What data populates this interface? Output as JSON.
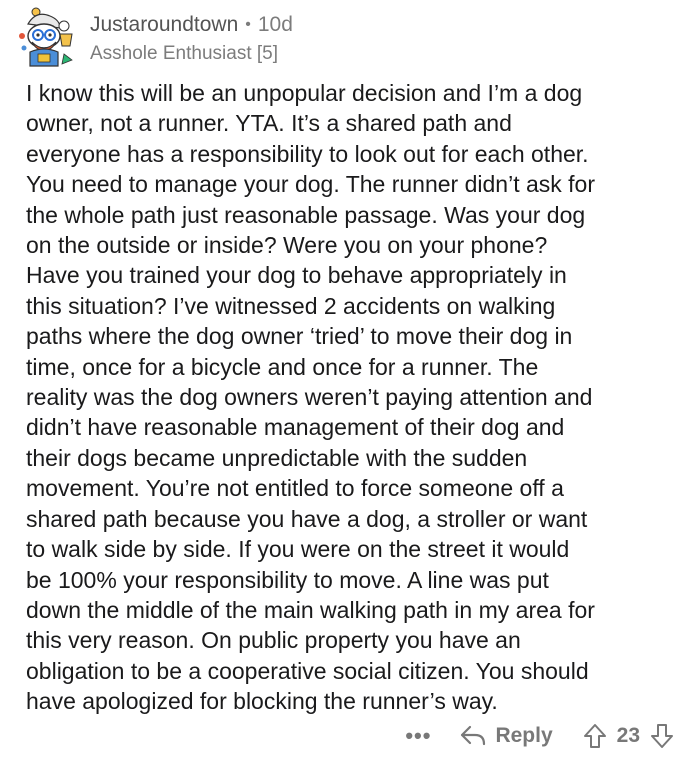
{
  "comment": {
    "username": "Justaroundtown",
    "separator": "•",
    "age": "10d",
    "flair": "Asshole Enthusiast [5]",
    "body": "I know this will be an unpopular decision and I’m a dog\nowner, not a runner. YTA. It’s a shared path and\neveryone has a responsibility to look out for each other.\nYou need to manage your dog. The runner didn’t ask for\nthe whole path just reasonable passage. Was your dog\non the outside or inside? Were you on your phone?\nHave you trained your dog to behave appropriately in\nthis situation? I’ve witnessed 2 accidents on walking\npaths where the dog owner ‘tried’ to move their dog in\ntime, once for a bicycle and once for a runner. The\nreality was the dog owners weren’t paying attention and\ndidn’t have reasonable management of their dog and\ntheir dogs became unpredictable with the sudden\nmovement. You’re not entitled to force someone off a\nshared path because you have a dog, a stroller or want\nto walk side by side. If you were on the street it would\nbe 100% your responsibility to move. A line was put\ndown the middle of the main walking path in my area for\nthis very reason. On public property you have an\nobligation to be a cooperative social citizen. You should\nhave apologized for blocking the runner’s way.",
    "more_label": "•••",
    "reply_label": "Reply",
    "score": "23"
  },
  "icons": {
    "avatar": "snoo-avatar-icon",
    "reply": "reply-arrow-icon",
    "upvote": "upvote-arrow-icon",
    "downvote": "downvote-arrow-icon"
  },
  "colors": {
    "meta_text": "#7c7c7c",
    "body_text": "#1a1a1b",
    "footer_text": "#787878"
  }
}
